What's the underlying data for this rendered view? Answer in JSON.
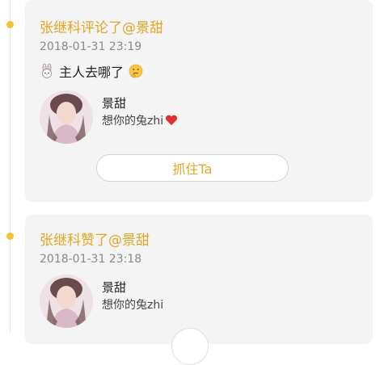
{
  "feed": [
    {
      "title": "张继科评论了@景甜",
      "time": "2018-01-31 23:19",
      "comment": "主人去哪了",
      "leading_icon": "rabbit-face-emoji-icon",
      "trailing_icon": "thinking-face-emoji-icon",
      "user_name": "景甜",
      "user_desc": "想你的兔zhi",
      "desc_icon": "red-heart-icon",
      "button_label": "抓住Ta"
    },
    {
      "title": "张继科赞了@景甜",
      "time": "2018-01-31 23:18",
      "user_name": "景甜",
      "user_desc": "想你的兔zhi"
    }
  ],
  "colors": {
    "accent": "#e3a624",
    "timeline_dot": "#f2c230",
    "card_bg": "#f4f4f4",
    "heart": "#e0312f"
  }
}
